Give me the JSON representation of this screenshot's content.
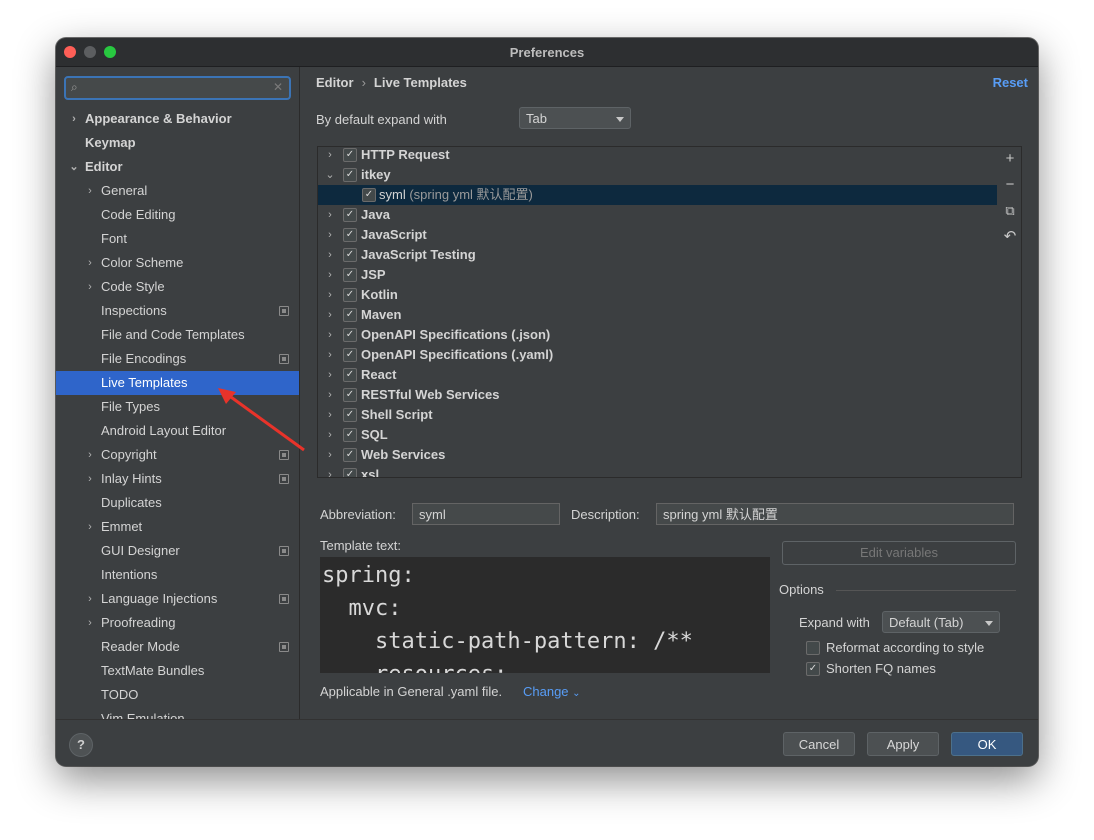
{
  "window": {
    "title": "Preferences"
  },
  "sidebar": {
    "search_placeholder": "",
    "items": [
      {
        "label": "Appearance & Behavior",
        "arrow": "›",
        "bold": true
      },
      {
        "label": "Keymap",
        "arrow": "",
        "bold": true
      },
      {
        "label": "Editor",
        "arrow": "⌄",
        "bold": true
      },
      {
        "label": "General",
        "arrow": "›"
      },
      {
        "label": "Code Editing",
        "arrow": ""
      },
      {
        "label": "Font",
        "arrow": ""
      },
      {
        "label": "Color Scheme",
        "arrow": "›"
      },
      {
        "label": "Code Style",
        "arrow": "›"
      },
      {
        "label": "Inspections",
        "arrow": "",
        "proj": true
      },
      {
        "label": "File and Code Templates",
        "arrow": ""
      },
      {
        "label": "File Encodings",
        "arrow": "",
        "proj": true
      },
      {
        "label": "Live Templates",
        "arrow": "",
        "selected": true
      },
      {
        "label": "File Types",
        "arrow": ""
      },
      {
        "label": "Android Layout Editor",
        "arrow": ""
      },
      {
        "label": "Copyright",
        "arrow": "›",
        "proj": true
      },
      {
        "label": "Inlay Hints",
        "arrow": "›",
        "proj": true
      },
      {
        "label": "Duplicates",
        "arrow": ""
      },
      {
        "label": "Emmet",
        "arrow": "›"
      },
      {
        "label": "GUI Designer",
        "arrow": "",
        "proj": true
      },
      {
        "label": "Intentions",
        "arrow": ""
      },
      {
        "label": "Language Injections",
        "arrow": "›",
        "proj": true
      },
      {
        "label": "Proofreading",
        "arrow": "›"
      },
      {
        "label": "Reader Mode",
        "arrow": "",
        "proj": true
      },
      {
        "label": "TextMate Bundles",
        "arrow": ""
      },
      {
        "label": "TODO",
        "arrow": ""
      },
      {
        "label": "Vim Emulation",
        "arrow": ""
      }
    ]
  },
  "main": {
    "breadcrumb": [
      "Editor",
      "Live Templates"
    ],
    "reset_label": "Reset",
    "expand_label": "By default expand with",
    "expand_value": "Tab",
    "templates": [
      {
        "label": "HTTP Request",
        "arrow": "›",
        "checked": true
      },
      {
        "label": "itkey",
        "arrow": "⌄",
        "checked": true
      },
      {
        "label": "syml",
        "desc": "(spring yml 默认配置)",
        "checked": true,
        "child": true,
        "selected": true
      },
      {
        "label": "Java",
        "arrow": "›",
        "checked": true
      },
      {
        "label": "JavaScript",
        "arrow": "›",
        "checked": true
      },
      {
        "label": "JavaScript Testing",
        "arrow": "›",
        "checked": true
      },
      {
        "label": "JSP",
        "arrow": "›",
        "checked": true
      },
      {
        "label": "Kotlin",
        "arrow": "›",
        "checked": true
      },
      {
        "label": "Maven",
        "arrow": "›",
        "checked": true
      },
      {
        "label": "OpenAPI Specifications (.json)",
        "arrow": "›",
        "checked": true
      },
      {
        "label": "OpenAPI Specifications (.yaml)",
        "arrow": "›",
        "checked": true
      },
      {
        "label": "React",
        "arrow": "›",
        "checked": true
      },
      {
        "label": "RESTful Web Services",
        "arrow": "›",
        "checked": true
      },
      {
        "label": "Shell Script",
        "arrow": "›",
        "checked": true
      },
      {
        "label": "SQL",
        "arrow": "›",
        "checked": true
      },
      {
        "label": "Web Services",
        "arrow": "›",
        "checked": true
      },
      {
        "label": "xsl",
        "arrow": "›",
        "checked": true
      }
    ],
    "tools": {
      "add": "+",
      "remove": "−",
      "copy": "⧉",
      "restore": "↶"
    },
    "abbreviation_label": "Abbreviation:",
    "abbreviation_value": "syml",
    "description_label": "Description:",
    "description_value": "spring yml 默认配置",
    "template_text_label": "Template text:",
    "edit_variables_label": "Edit variables",
    "code_lines": [
      "spring:",
      "  mvc:",
      "    static-path-pattern: /**",
      "    resources:"
    ],
    "options_title": "Options",
    "expand_with_label": "Expand with",
    "expand_with_value": "Default (Tab)",
    "reformat_label": "Reformat according to style",
    "reformat_checked": false,
    "shorten_label": "Shorten FQ names",
    "shorten_checked": true,
    "applicable_text": "Applicable in General .yaml file.",
    "change_label": "Change"
  },
  "footer": {
    "help": "?",
    "cancel": "Cancel",
    "apply": "Apply",
    "ok": "OK"
  },
  "colors": {
    "selection": "#2f65ca",
    "link": "#589df6",
    "annotation_arrow": "#e8332a"
  }
}
